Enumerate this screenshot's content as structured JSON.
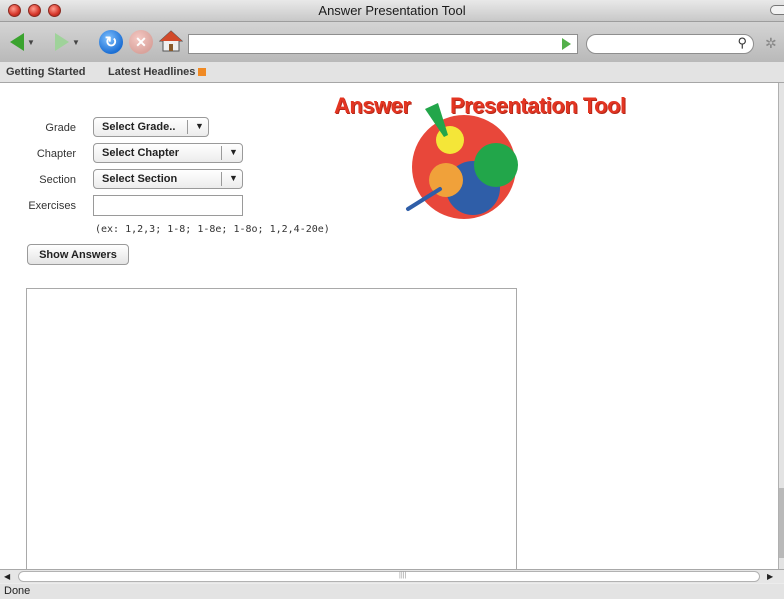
{
  "window": {
    "title": "Answer Presentation Tool"
  },
  "toolbar": {
    "url_value": "",
    "search_value": ""
  },
  "bookmarks": [
    {
      "label": "Getting Started"
    },
    {
      "label": "Latest Headlines"
    }
  ],
  "logo": {
    "word1": "Answer",
    "word2": "Presentation Tool",
    "colors": {
      "text": "#e33522",
      "red": "#e8473a",
      "yellow": "#f4e638",
      "green": "#22a64a",
      "blue": "#2f5ea8",
      "orange": "#f0a13a"
    }
  },
  "form": {
    "grade": {
      "label": "Grade",
      "value": "Select Grade.."
    },
    "chapter": {
      "label": "Chapter",
      "value": "Select Chapter"
    },
    "section": {
      "label": "Section",
      "value": "Select Section"
    },
    "exercises": {
      "label": "Exercises",
      "value": ""
    },
    "hint": "(ex: 1,2,3; 1-8; 1-8e; 1-8o; 1,2,4-20e)",
    "button": "Show Answers"
  },
  "status": {
    "text": "Done"
  },
  "icons": {
    "back": "back-arrow-icon",
    "forward": "forward-arrow-icon",
    "reload": "reload-icon",
    "stop": "stop-icon",
    "home": "home-icon",
    "go": "go-arrow-icon",
    "search": "magnifier-icon",
    "activity": "spinner-icon",
    "rss": "rss-feed-icon"
  }
}
